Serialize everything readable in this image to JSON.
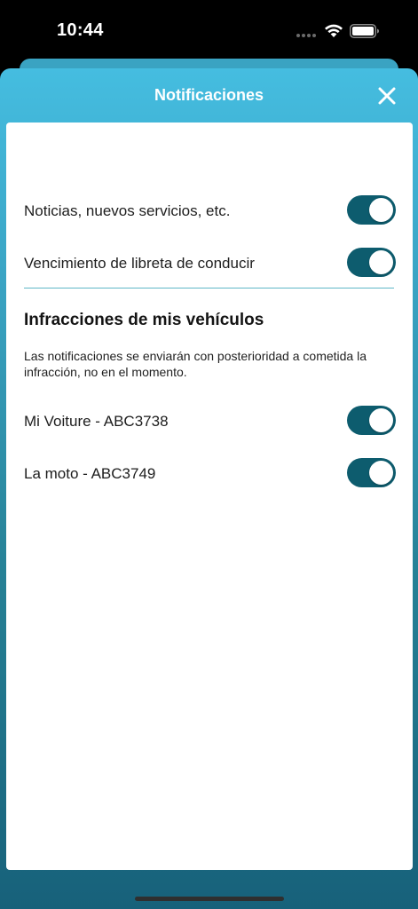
{
  "status_bar": {
    "time": "10:44",
    "icons": [
      "signal-dots-icon",
      "wifi-icon",
      "battery-icon"
    ]
  },
  "sheet": {
    "title": "Notificaciones",
    "close_icon": "close-icon"
  },
  "general_settings": [
    {
      "label": "Noticias, nuevos servicios, etc.",
      "enabled": true
    },
    {
      "label": "Vencimiento de libreta de conducir",
      "enabled": true
    }
  ],
  "vehicles_section": {
    "title": "Infracciones de mis vehículos",
    "note": "Las notificaciones se enviarán con posterioridad a cometida la infracción, no en el momento.",
    "vehicles": [
      {
        "label": "Mi Voiture - ABC3738",
        "enabled": true
      },
      {
        "label": "La moto - ABC3749",
        "enabled": true
      }
    ]
  },
  "colors": {
    "header_gradient_top": "#45bde0",
    "header_gradient_bottom": "#17617a",
    "toggle_on": "#0d5c6e",
    "divider": "#5fb7c7"
  }
}
